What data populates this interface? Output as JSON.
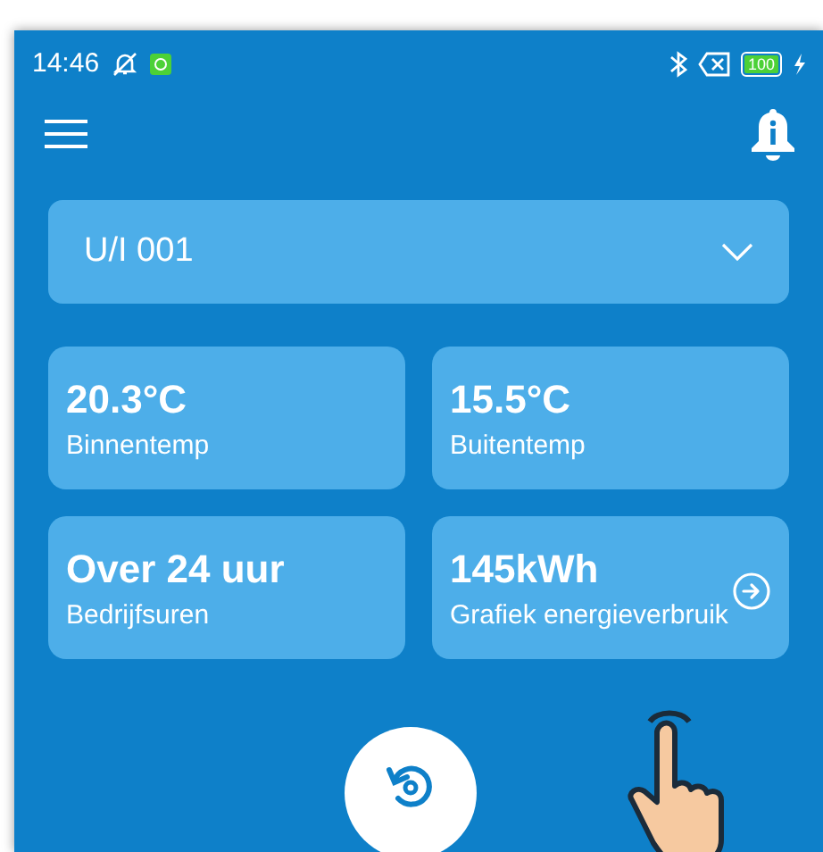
{
  "status_bar": {
    "time": "14:46",
    "battery": "100"
  },
  "selector": {
    "value": "U/I 001"
  },
  "cards": [
    {
      "kind": "plain",
      "value": "20.3°C",
      "label": "Binnentemp"
    },
    {
      "kind": "plain",
      "value": "15.5°C",
      "label": "Buitentemp"
    },
    {
      "kind": "plain",
      "value": "Over 24 uur",
      "label": "Bedrijfsuren"
    },
    {
      "kind": "link",
      "value": "145kWh",
      "label": "Grafiek energieverbruik"
    }
  ]
}
